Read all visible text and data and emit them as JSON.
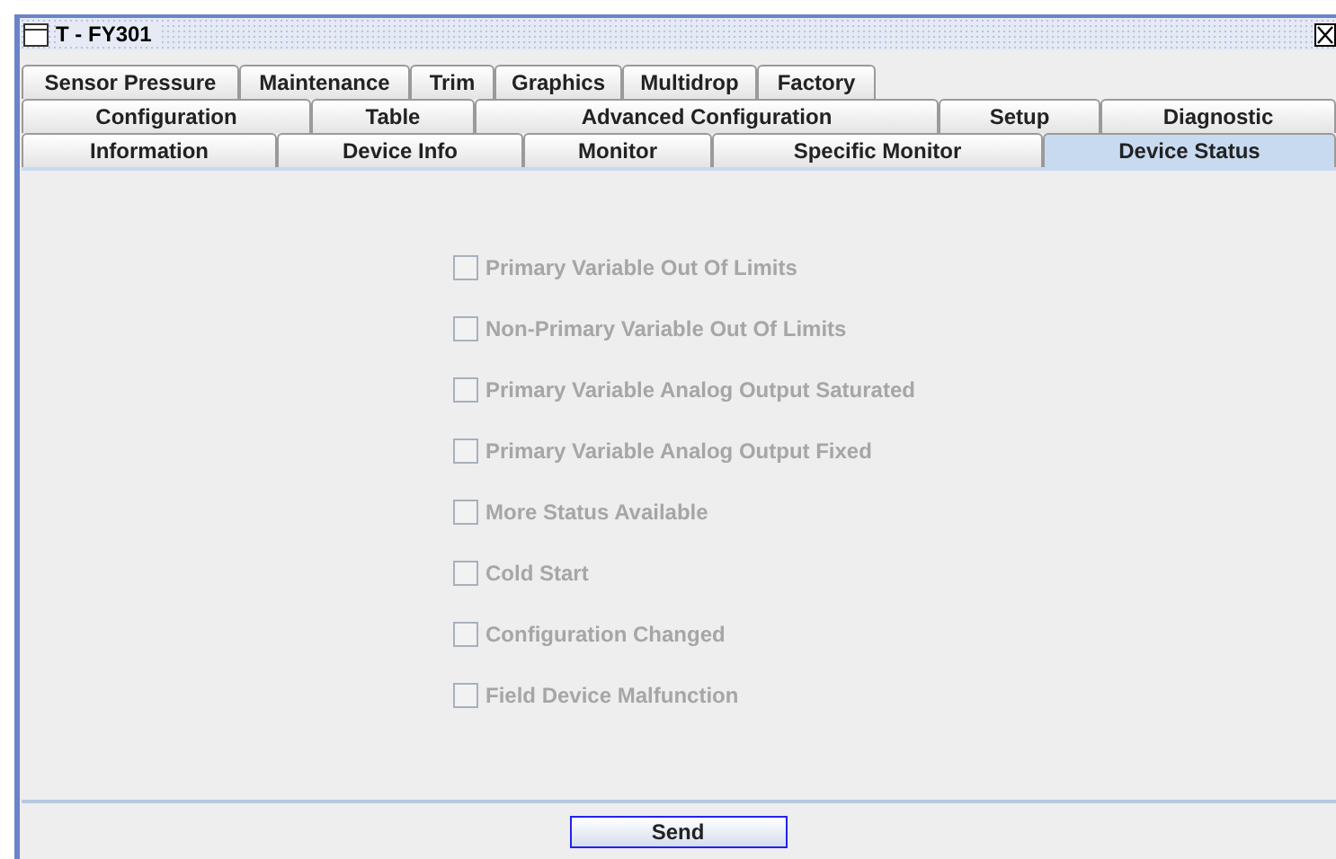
{
  "window": {
    "title": "T - FY301"
  },
  "tab_rows": [
    [
      {
        "label": "Sensor Pressure",
        "selected": false
      },
      {
        "label": "Maintenance",
        "selected": false
      },
      {
        "label": "Trim",
        "selected": false
      },
      {
        "label": "Graphics",
        "selected": false
      },
      {
        "label": "Multidrop",
        "selected": false
      },
      {
        "label": "Factory",
        "selected": false
      }
    ],
    [
      {
        "label": "Configuration",
        "selected": false
      },
      {
        "label": "Table",
        "selected": false
      },
      {
        "label": "Advanced Configuration",
        "selected": false
      },
      {
        "label": "Setup",
        "selected": false
      },
      {
        "label": "Diagnostic",
        "selected": false
      }
    ],
    [
      {
        "label": "Information",
        "selected": false
      },
      {
        "label": "Device Info",
        "selected": false
      },
      {
        "label": "Monitor",
        "selected": false
      },
      {
        "label": "Specific Monitor",
        "selected": false
      },
      {
        "label": "Device Status",
        "selected": true
      }
    ]
  ],
  "status_flags": [
    {
      "label": "Primary Variable Out Of Limits",
      "checked": false,
      "disabled": true
    },
    {
      "label": "Non-Primary Variable Out Of Limits",
      "checked": false,
      "disabled": true
    },
    {
      "label": "Primary Variable Analog Output Saturated",
      "checked": false,
      "disabled": true
    },
    {
      "label": "Primary Variable Analog Output Fixed",
      "checked": false,
      "disabled": true
    },
    {
      "label": "More Status Available",
      "checked": false,
      "disabled": true
    },
    {
      "label": "Cold Start",
      "checked": false,
      "disabled": true
    },
    {
      "label": "Configuration Changed",
      "checked": false,
      "disabled": true
    },
    {
      "label": "Field Device Malfunction",
      "checked": false,
      "disabled": true
    }
  ],
  "buttons": [
    {
      "label": "Send"
    }
  ]
}
